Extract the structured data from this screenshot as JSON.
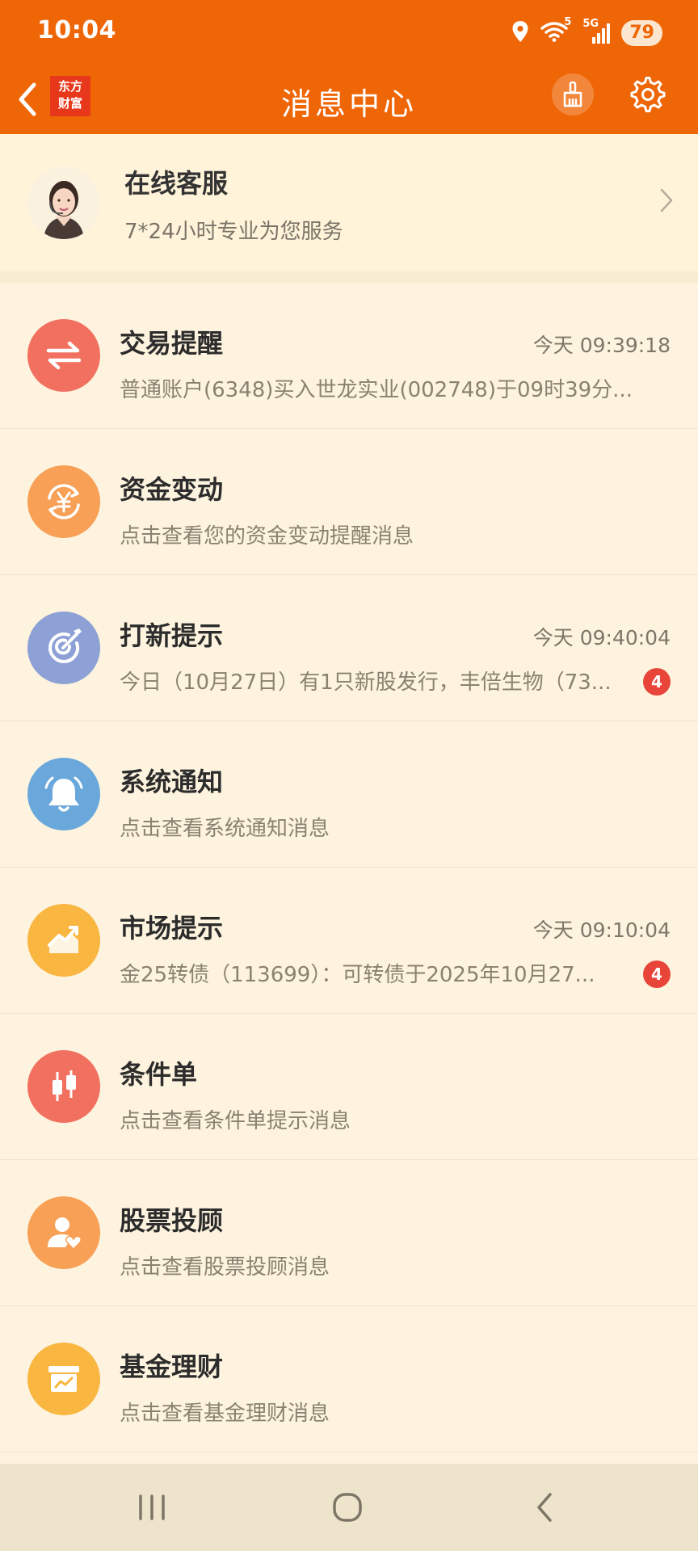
{
  "status_bar": {
    "time": "10:04",
    "network": "5G",
    "wifi_label": "5",
    "battery": "79"
  },
  "nav": {
    "title": "消息中心",
    "logo_line1": "东方",
    "logo_line2": "财富",
    "accent_color": "#ef6606"
  },
  "service": {
    "title": "在线客服",
    "subtitle": "7*24小时专业为您服务"
  },
  "messages": [
    {
      "title": "交易提醒",
      "time": "今天 09:39:18",
      "preview": "普通账户(6348)买入世龙实业(002748)于09时39分...",
      "icon": "exchange-arrows-icon",
      "color": "#f2705f"
    },
    {
      "title": "资金变动",
      "time": "",
      "preview": "点击查看您的资金变动提醒消息",
      "icon": "yen-cycle-icon",
      "color": "#f7a056"
    },
    {
      "title": "打新提示",
      "time": "今天 09:40:04",
      "preview": "今日（10月27日）有1只新股发行，丰倍生物（73...",
      "badge": "4",
      "icon": "target-icon",
      "color": "#8da1d6"
    },
    {
      "title": "系统通知",
      "time": "",
      "preview": "点击查看系统通知消息",
      "icon": "bell-icon",
      "color": "#6aa8dc"
    },
    {
      "title": "市场提示",
      "time": "今天 09:10:04",
      "preview": "金25转债（113699）：可转债于2025年10月27...",
      "badge": "4",
      "icon": "trend-chart-icon",
      "color": "#f9b640"
    },
    {
      "title": "条件单",
      "time": "",
      "preview": "点击查看条件单提示消息",
      "icon": "candlestick-icon",
      "color": "#f2705f"
    },
    {
      "title": "股票投顾",
      "time": "",
      "preview": "点击查看股票投顾消息",
      "icon": "advisor-icon",
      "color": "#f7a056"
    },
    {
      "title": "基金理财",
      "time": "",
      "preview": "点击查看基金理财消息",
      "icon": "fund-box-icon",
      "color": "#f9b640"
    }
  ]
}
